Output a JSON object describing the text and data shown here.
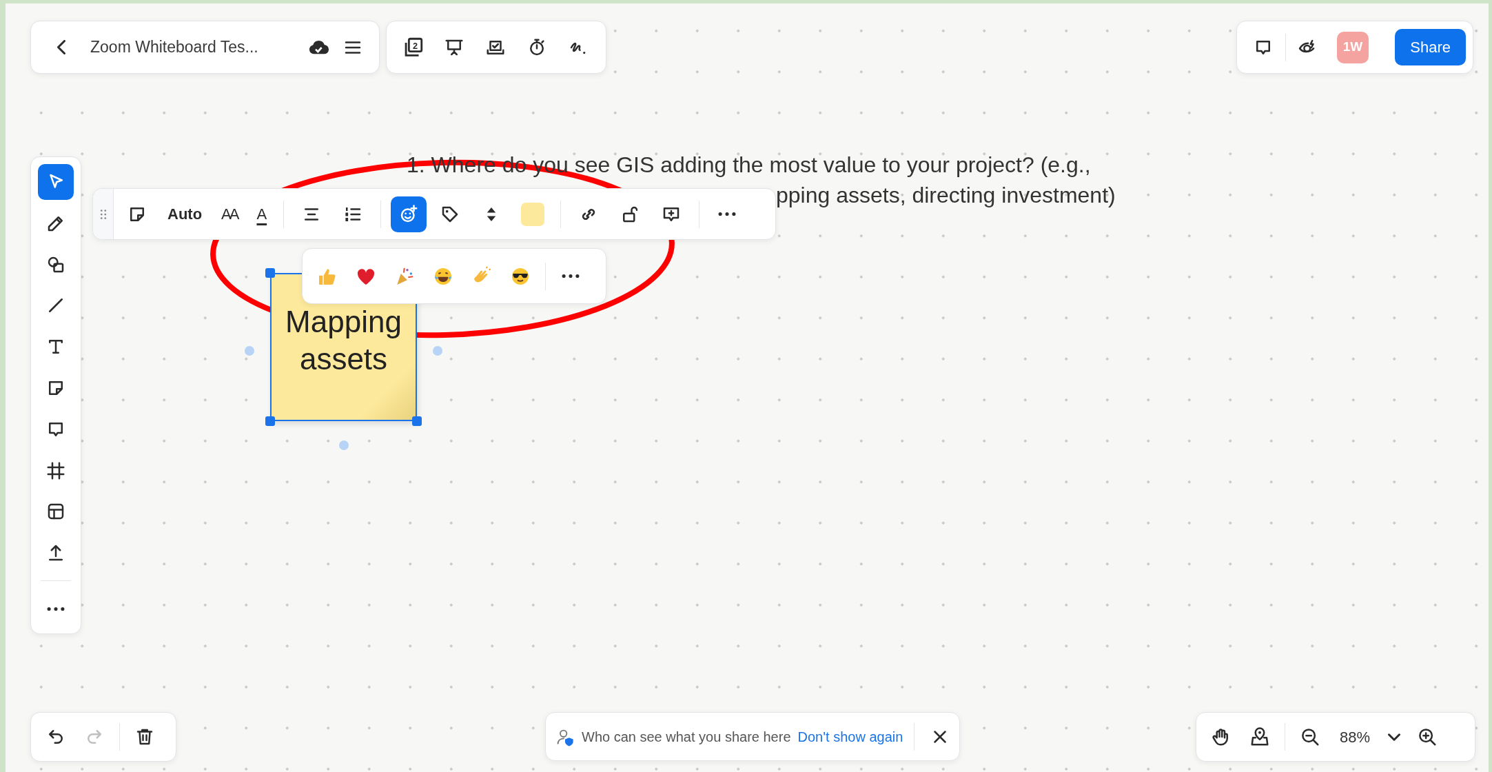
{
  "header": {
    "title": "Zoom Whiteboard Tes..."
  },
  "top_tools": [
    {
      "kind": "pages",
      "count": "2"
    },
    {
      "kind": "present"
    },
    {
      "kind": "vote"
    },
    {
      "kind": "timer"
    },
    {
      "kind": "signature"
    }
  ],
  "top_right": {
    "initials": "1W",
    "share": "Share"
  },
  "left_tools": [
    {
      "kind": "select",
      "selected": true
    },
    {
      "kind": "pen",
      "selected": false
    },
    {
      "kind": "shapes",
      "selected": false
    },
    {
      "kind": "line",
      "selected": false
    },
    {
      "kind": "text",
      "selected": false
    },
    {
      "kind": "sticky",
      "selected": false
    },
    {
      "kind": "comment",
      "selected": false
    },
    {
      "kind": "frame",
      "selected": false
    },
    {
      "kind": "template",
      "selected": false
    },
    {
      "kind": "upload",
      "selected": false
    },
    {
      "kind": "more",
      "selected": false
    }
  ],
  "format_toolbar": {
    "font_size": "Auto",
    "size_glyph": "AA",
    "color_glyph": "A",
    "reaction_selected": true
  },
  "reactions": [
    {
      "kind": "thumbs"
    },
    {
      "kind": "heart"
    },
    {
      "kind": "party"
    },
    {
      "kind": "laugh"
    },
    {
      "kind": "clap"
    },
    {
      "kind": "cool"
    }
  ],
  "canvas": {
    "question_line_1": "1. Where do you see GIS adding the most value to your project? (e.g.,",
    "question_line_2_visible": "pping assets, directing investment)",
    "sticky": {
      "text": "Mapping assets",
      "color": "#fde99b",
      "selected": true
    }
  },
  "history": {
    "redo_disabled": true
  },
  "notice": {
    "text": "Who can see what you share here",
    "link": "Don't show again"
  },
  "zoom": {
    "value": "88%"
  }
}
